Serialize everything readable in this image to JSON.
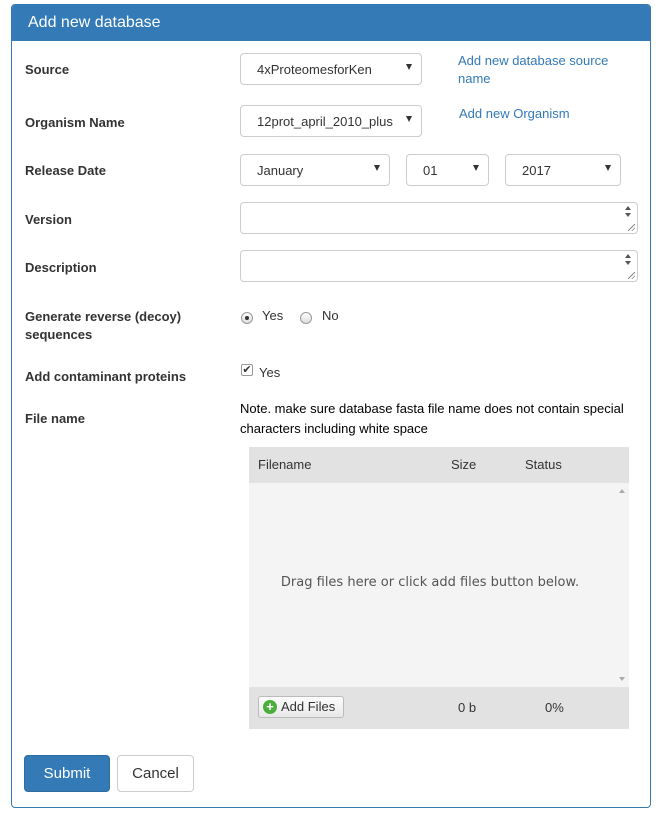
{
  "panel": {
    "title": "Add new database"
  },
  "source": {
    "label": "Source",
    "value": "4xProteomesforKen",
    "add_link": "Add new database source name"
  },
  "organism": {
    "label": "Organism Name",
    "value": "12prot_april_2010_plus",
    "add_link": "Add new Organism"
  },
  "release_date": {
    "label": "Release Date",
    "month": "January",
    "day": "01",
    "year": "2017"
  },
  "version": {
    "label": "Version",
    "value": ""
  },
  "description": {
    "label": "Description",
    "value": ""
  },
  "decoy": {
    "label": "Generate reverse (decoy) sequences",
    "options": [
      "Yes",
      "No"
    ],
    "selected": "Yes"
  },
  "contaminant": {
    "label": "Add contaminant proteins",
    "option": "Yes",
    "checked": true
  },
  "file": {
    "label": "File name",
    "note": "Note. make sure database fasta file name does not contain special characters including white space",
    "columns": [
      "Filename",
      "Size",
      "Status"
    ],
    "drop_hint": "Drag files here or click add files button below.",
    "add_files_label": "Add Files",
    "total_size": "0 b",
    "total_percent": "0%"
  },
  "actions": {
    "submit": "Submit",
    "cancel": "Cancel"
  },
  "colors": {
    "primary": "#337ab7",
    "add_icon": "#4bae3c"
  }
}
